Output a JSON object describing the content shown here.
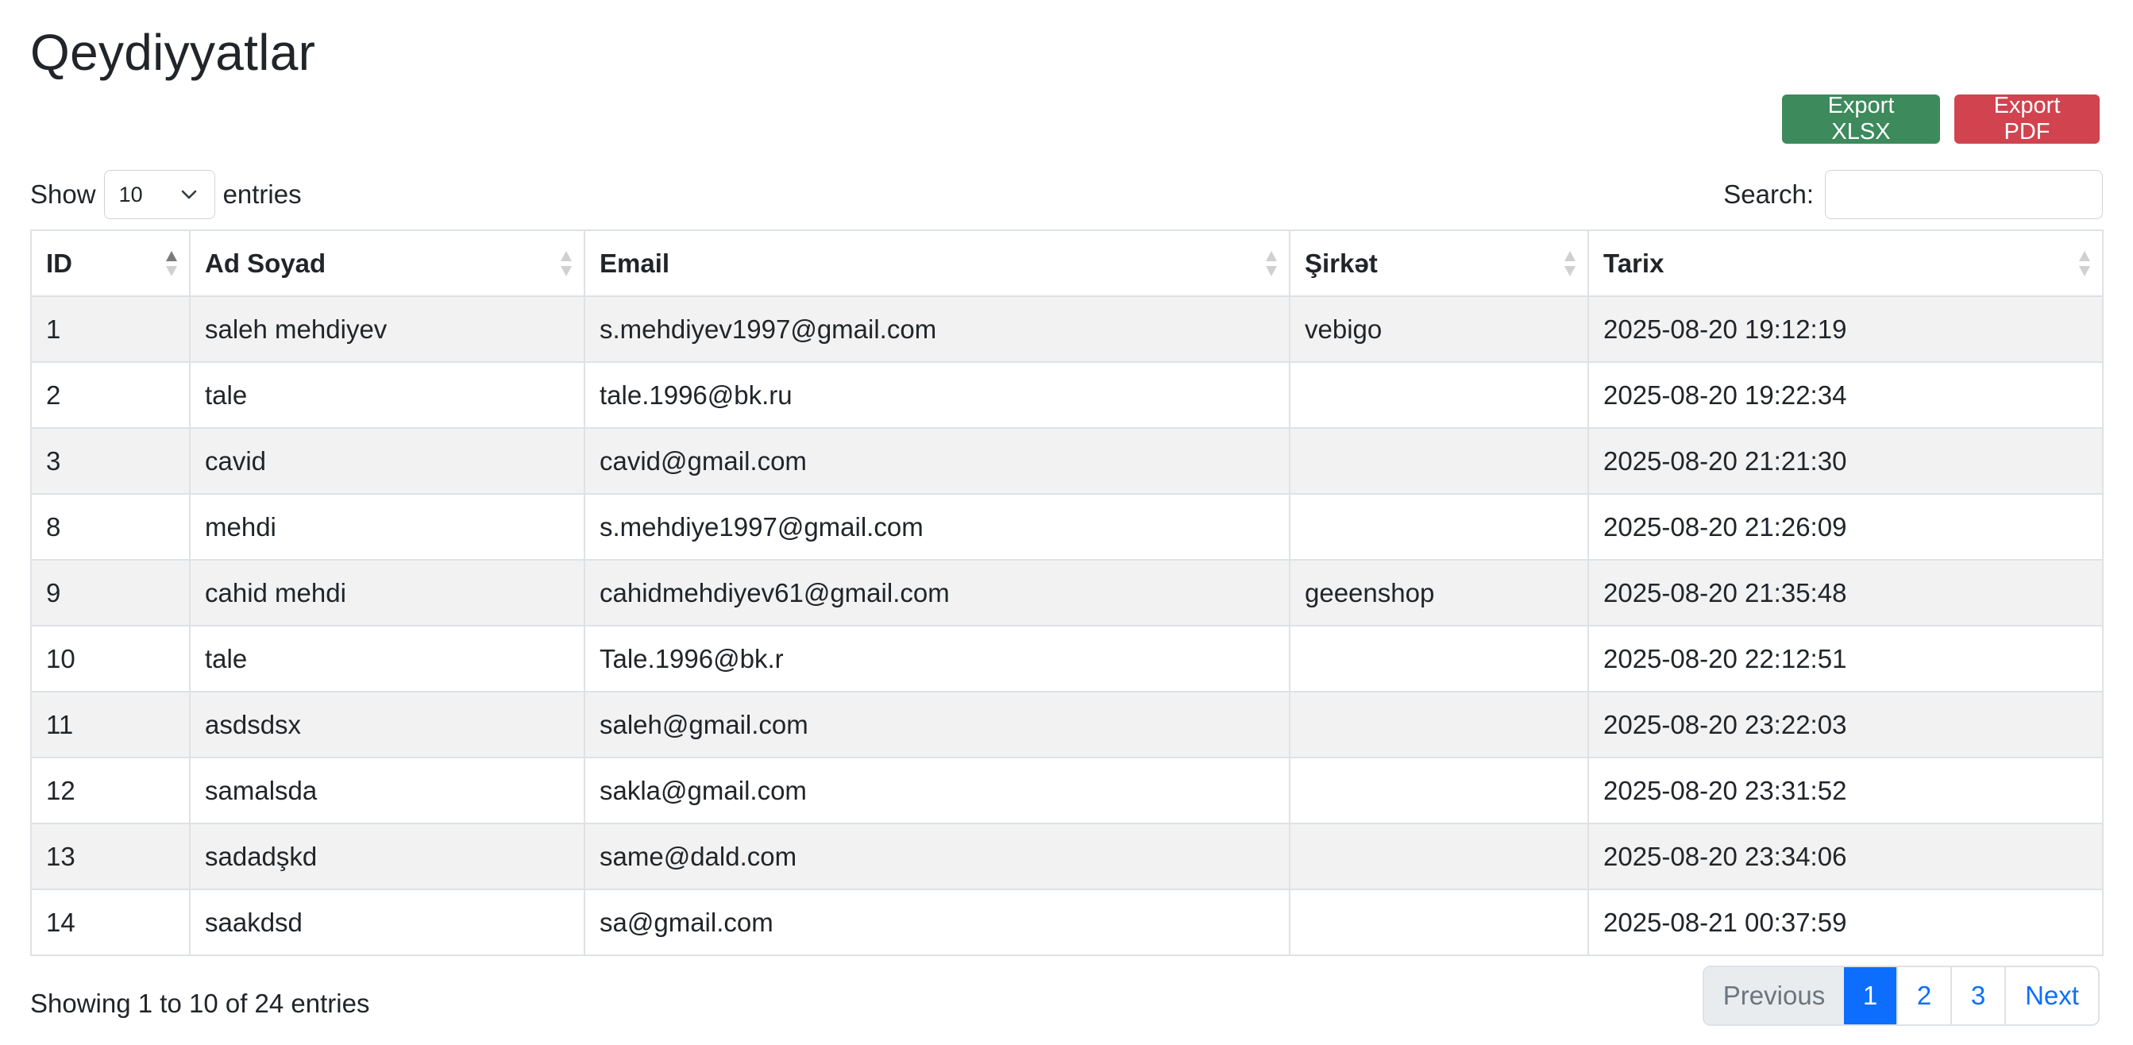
{
  "page": {
    "title": "Qeydiyyatlar"
  },
  "export": {
    "xlsx_label": "Export XLSX",
    "pdf_label": "Export PDF"
  },
  "length": {
    "show_label": "Show",
    "value": "10",
    "entries_label": "entries"
  },
  "search": {
    "label": "Search:",
    "value": ""
  },
  "table": {
    "columns": [
      "ID",
      "Ad Soyad",
      "Email",
      "Şirkət",
      "Tarix"
    ],
    "rows": [
      [
        "1",
        "saleh mehdiyev",
        "s.mehdiyev1997@gmail.com",
        "vebigo",
        "2025-08-20 19:12:19"
      ],
      [
        "2",
        "tale",
        "tale.1996@bk.ru",
        "",
        "2025-08-20 19:22:34"
      ],
      [
        "3",
        "cavid",
        "cavid@gmail.com",
        "",
        "2025-08-20 21:21:30"
      ],
      [
        "8",
        "mehdi",
        "s.mehdiye1997@gmail.com",
        "",
        "2025-08-20 21:26:09"
      ],
      [
        "9",
        "cahid mehdi",
        "cahidmehdiyev61@gmail.com",
        "geeenshop",
        "2025-08-20 21:35:48"
      ],
      [
        "10",
        "tale",
        "Tale.1996@bk.r",
        "",
        "2025-08-20 22:12:51"
      ],
      [
        "11",
        "asdsdsx",
        "saleh@gmail.com",
        "",
        "2025-08-20 23:22:03"
      ],
      [
        "12",
        "samalsda",
        "sakla@gmail.com",
        "",
        "2025-08-20 23:31:52"
      ],
      [
        "13",
        "sadadşkd",
        "same@dald.com",
        "",
        "2025-08-20 23:34:06"
      ],
      [
        "14",
        "saakdsd",
        "sa@gmail.com",
        "",
        "2025-08-21 00:37:59"
      ]
    ]
  },
  "info": {
    "text": "Showing 1 to 10 of 24 entries"
  },
  "pagination": {
    "previous_label": "Previous",
    "pages": [
      "1",
      "2",
      "3"
    ],
    "active_page": "1",
    "next_label": "Next"
  },
  "colors": {
    "export_xlsx": "#3d8a5c",
    "export_pdf": "#d1434f",
    "active_page": "#0d6efd",
    "link": "#0d6efd",
    "striped_row": "#f2f2f2"
  },
  "icons": {
    "select_arrow": "chevron-down-icon",
    "sort_active": "sort-asc-icon",
    "sort_inactive": "sort-both-icon"
  }
}
